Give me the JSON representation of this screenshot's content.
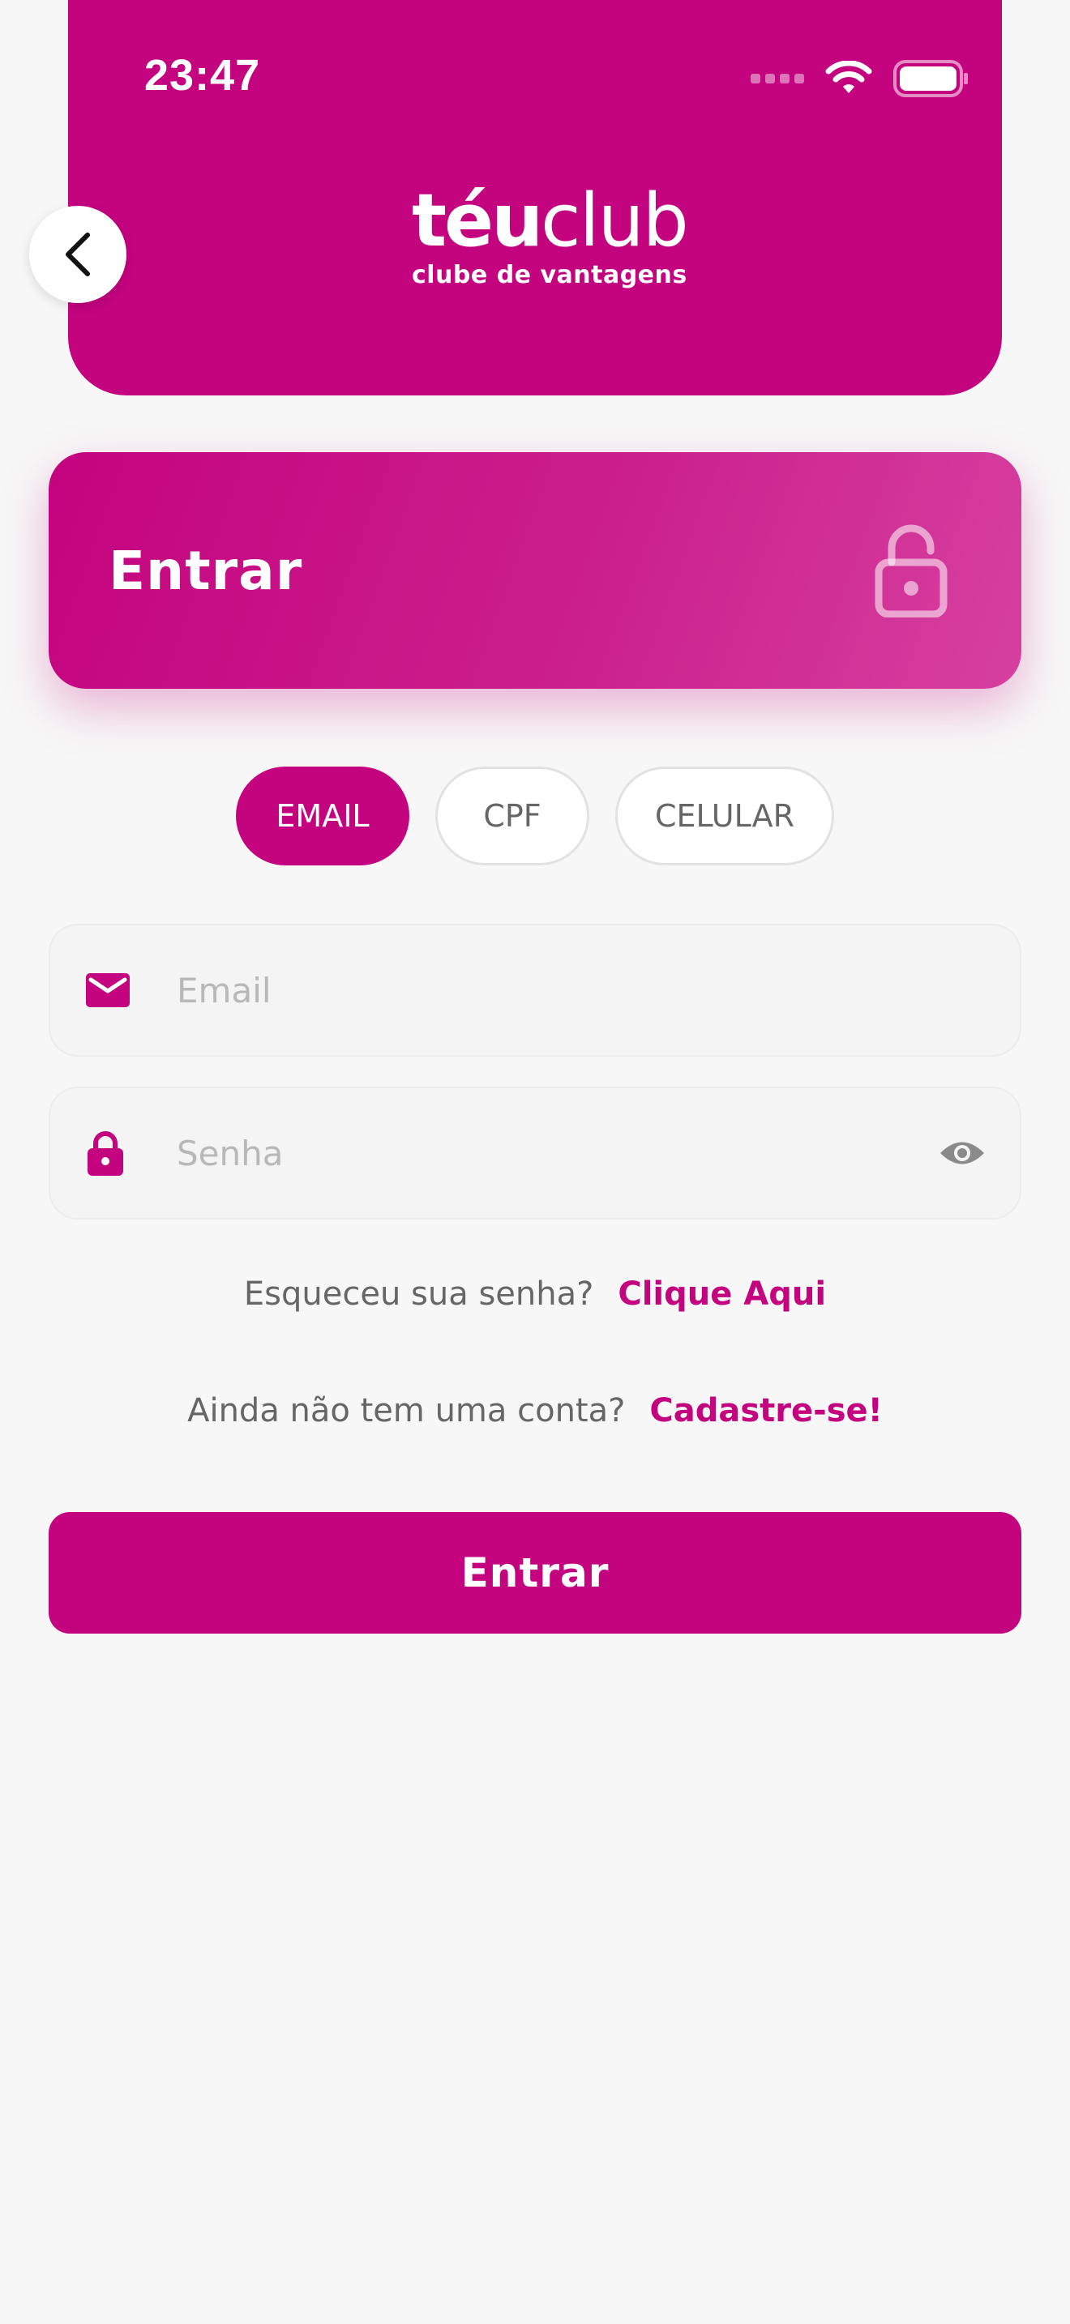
{
  "status_bar": {
    "time": "23:47"
  },
  "header": {
    "logo_part1": "téu",
    "logo_part2": "club",
    "logo_tagline": "clube de vantagens"
  },
  "title_card": {
    "title": "Entrar",
    "icon": "lock-open-icon"
  },
  "tabs": [
    {
      "label": "EMAIL",
      "active": true
    },
    {
      "label": "CPF",
      "active": false
    },
    {
      "label": "CELULAR",
      "active": false
    }
  ],
  "form": {
    "email": {
      "placeholder": "Email",
      "value": "",
      "icon": "mail-icon"
    },
    "password": {
      "placeholder": "Senha",
      "value": "",
      "icon": "lock-icon",
      "toggle_icon": "eye-icon"
    }
  },
  "forgot": {
    "text": "Esqueceu sua senha?",
    "link": "Clique Aqui"
  },
  "signup": {
    "text": "Ainda não tem uma conta?",
    "link": "Cadastre-se!"
  },
  "submit": {
    "label": "Entrar"
  },
  "colors": {
    "brand": "#c4037f",
    "background": "#f7f7f7"
  }
}
